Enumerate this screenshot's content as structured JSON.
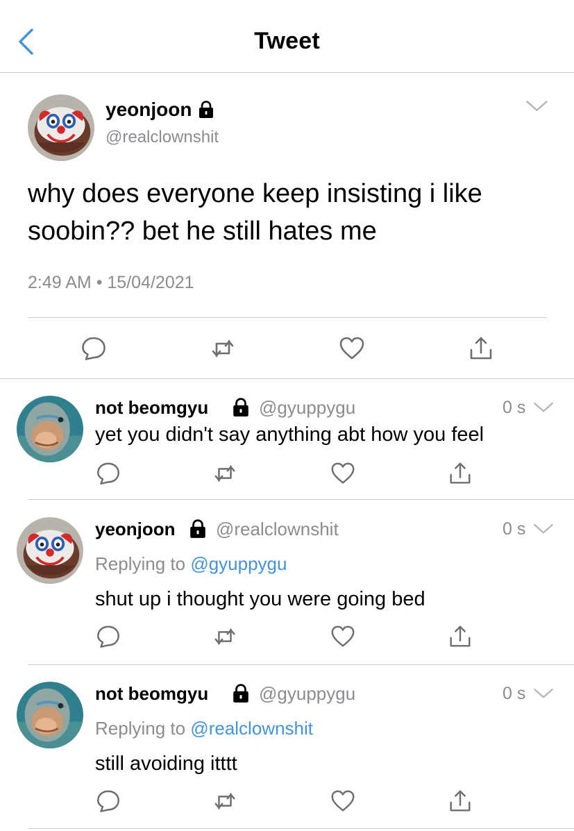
{
  "header": {
    "title": "Tweet",
    "back_icon": "chevron-left-icon"
  },
  "main_tweet": {
    "name": "yeonjoon",
    "handle": "@realclownshit",
    "text": "why does everyone keep insisting i like soobin?? bet he still hates me",
    "time": "2:49 AM",
    "date": "15/04/2021",
    "meta_separator": "•"
  },
  "replies": [
    {
      "name": "not beomgyu",
      "handle": "@gyuppygu",
      "time": "0 s",
      "replying_prefix": "",
      "replying_to": "",
      "text": "yet you didn't say anything abt how you feel"
    },
    {
      "name": "yeonjoon",
      "handle": "@realclownshit",
      "time": "0 s",
      "replying_prefix": "Replying to",
      "replying_to": "@gyuppygu",
      "text": "shut up i thought you were going bed"
    },
    {
      "name": "not beomgyu",
      "handle": "@gyuppygu",
      "time": "0 s",
      "replying_prefix": "Replying to",
      "replying_to": "@realclownshit",
      "text": "still avoiding itttt"
    }
  ],
  "colors": {
    "accent": "#3f93df",
    "muted": "#8b8b92",
    "divider": "#c9c9ce"
  }
}
